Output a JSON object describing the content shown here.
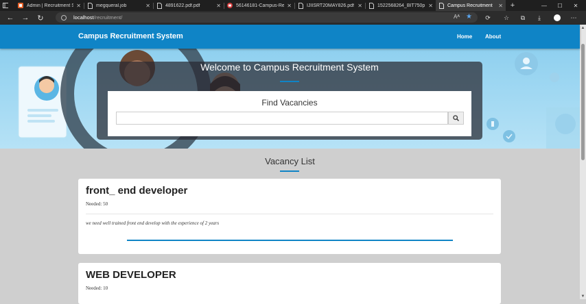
{
  "browser": {
    "tabs": [
      {
        "label": "Admin | Recruitment S",
        "icon": "app-orange-icon",
        "active": false
      },
      {
        "label": "megqueral.job",
        "icon": "file-icon",
        "active": false
      },
      {
        "label": "4891622.pdf.pdf",
        "icon": "file-icon",
        "active": false
      },
      {
        "label": "56146181-Campus-Re",
        "icon": "pdf-red-icon",
        "active": false
      },
      {
        "label": "IJIISRT20MAY826.pdf",
        "icon": "file-icon",
        "active": false
      },
      {
        "label": "1522568264_BIT750p",
        "icon": "file-icon",
        "active": false
      },
      {
        "label": "Campus Recruitment",
        "icon": "file-icon",
        "active": true
      }
    ],
    "url_host": "localhost",
    "url_path": "/recruitment/",
    "reader_label": "Aᴬ"
  },
  "site": {
    "brand": "Campus Recruitment System",
    "nav": {
      "home": "Home",
      "about": "About"
    }
  },
  "hero": {
    "title": "Welcome to Campus Recruitment System",
    "find_title": "Find Vacancies",
    "search_value": "",
    "search_placeholder": ""
  },
  "vacancy_list": {
    "title": "Vacancy List",
    "items": [
      {
        "title": "front_ end developer",
        "needed": "Needed: 50",
        "description": "we need well trained front end develop with the experience of 2 years"
      },
      {
        "title": "WEB DEVELOPER",
        "needed": "Needed: 10",
        "description": ""
      }
    ]
  },
  "colors": {
    "accent": "#0f84c6",
    "background": "#cfcfcf",
    "hero": "#a6dcf3"
  }
}
